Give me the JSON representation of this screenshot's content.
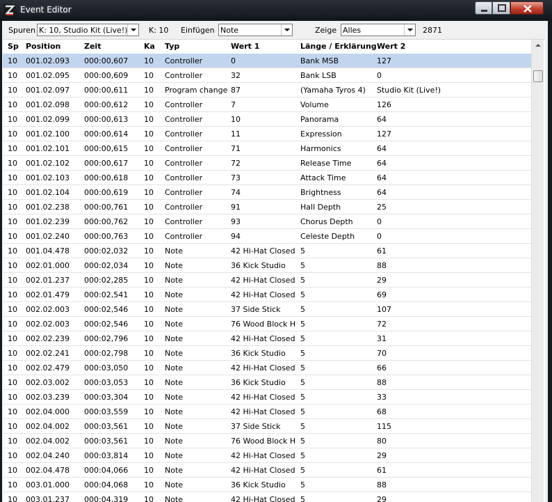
{
  "window": {
    "title": "Event Editor",
    "icon": "z-app-icon"
  },
  "toolbar": {
    "spuren_label": "Spuren",
    "spuren_value": "K: 10, Studio Kit (Live!)",
    "channel_label": "K: 10",
    "einfuegen_label": "Einfügen",
    "einfuegen_value": "Note",
    "zeige_label": "Zeige",
    "zeige_value": "Alles",
    "count": "2871"
  },
  "columns": {
    "sp": "Sp",
    "position": "Position",
    "zeit": "Zeit",
    "ka": "Ka",
    "typ": "Typ",
    "wert1": "Wert 1",
    "laenge": "Länge / Erklärung",
    "wert2": "Wert 2"
  },
  "selected_color": "#c1d5ee",
  "events": [
    {
      "sp": "10",
      "position": "001.02.093",
      "zeit": "000:00,607",
      "ka": "10",
      "typ": "Controller",
      "wert1": "0",
      "laenge": "Bank MSB",
      "wert2": "127"
    },
    {
      "sp": "10",
      "position": "001.02.095",
      "zeit": "000:00,609",
      "ka": "10",
      "typ": "Controller",
      "wert1": "32",
      "laenge": "Bank LSB",
      "wert2": "0"
    },
    {
      "sp": "10",
      "position": "001.02.097",
      "zeit": "000:00,611",
      "ka": "10",
      "typ": "Program change",
      "wert1": "87",
      "laenge": "(Yamaha Tyros 4)",
      "wert2": "Studio Kit (Live!)"
    },
    {
      "sp": "10",
      "position": "001.02.098",
      "zeit": "000:00,612",
      "ka": "10",
      "typ": "Controller",
      "wert1": "7",
      "laenge": "Volume",
      "wert2": "126"
    },
    {
      "sp": "10",
      "position": "001.02.099",
      "zeit": "000:00,613",
      "ka": "10",
      "typ": "Controller",
      "wert1": "10",
      "laenge": "Panorama",
      "wert2": "64"
    },
    {
      "sp": "10",
      "position": "001.02.100",
      "zeit": "000:00,614",
      "ka": "10",
      "typ": "Controller",
      "wert1": "11",
      "laenge": "Expression",
      "wert2": "127"
    },
    {
      "sp": "10",
      "position": "001.02.101",
      "zeit": "000:00,615",
      "ka": "10",
      "typ": "Controller",
      "wert1": "71",
      "laenge": "Harmonics",
      "wert2": "64"
    },
    {
      "sp": "10",
      "position": "001.02.102",
      "zeit": "000:00,617",
      "ka": "10",
      "typ": "Controller",
      "wert1": "72",
      "laenge": "Release Time",
      "wert2": "64"
    },
    {
      "sp": "10",
      "position": "001.02.103",
      "zeit": "000:00,618",
      "ka": "10",
      "typ": "Controller",
      "wert1": "73",
      "laenge": "Attack Time",
      "wert2": "64"
    },
    {
      "sp": "10",
      "position": "001.02.104",
      "zeit": "000:00,619",
      "ka": "10",
      "typ": "Controller",
      "wert1": "74",
      "laenge": "Brightness",
      "wert2": "64"
    },
    {
      "sp": "10",
      "position": "001.02.238",
      "zeit": "000:00,761",
      "ka": "10",
      "typ": "Controller",
      "wert1": "91",
      "laenge": "Hall Depth",
      "wert2": "25"
    },
    {
      "sp": "10",
      "position": "001.02.239",
      "zeit": "000:00,762",
      "ka": "10",
      "typ": "Controller",
      "wert1": "93",
      "laenge": "Chorus Depth",
      "wert2": "0"
    },
    {
      "sp": "10",
      "position": "001.02.240",
      "zeit": "000:00,763",
      "ka": "10",
      "typ": "Controller",
      "wert1": "94",
      "laenge": "Celeste Depth",
      "wert2": "0"
    },
    {
      "sp": "10",
      "position": "001.04.478",
      "zeit": "000:02,032",
      "ka": "10",
      "typ": "Note",
      "wert1": "42 Hi-Hat Closed",
      "laenge": "5",
      "wert2": "61"
    },
    {
      "sp": "10",
      "position": "002.01.000",
      "zeit": "000:02,034",
      "ka": "10",
      "typ": "Note",
      "wert1": "36 Kick Studio",
      "laenge": "5",
      "wert2": "88"
    },
    {
      "sp": "10",
      "position": "002.01.237",
      "zeit": "000:02,285",
      "ka": "10",
      "typ": "Note",
      "wert1": "42 Hi-Hat Closed",
      "laenge": "5",
      "wert2": "29"
    },
    {
      "sp": "10",
      "position": "002.01.479",
      "zeit": "000:02,541",
      "ka": "10",
      "typ": "Note",
      "wert1": "42 Hi-Hat Closed",
      "laenge": "5",
      "wert2": "69"
    },
    {
      "sp": "10",
      "position": "002.02.003",
      "zeit": "000:02,546",
      "ka": "10",
      "typ": "Note",
      "wert1": "37 Side Stick",
      "laenge": "5",
      "wert2": "107"
    },
    {
      "sp": "10",
      "position": "002.02.003",
      "zeit": "000:02,546",
      "ka": "10",
      "typ": "Note",
      "wert1": "76 Wood Block H",
      "laenge": "5",
      "wert2": "72"
    },
    {
      "sp": "10",
      "position": "002.02.239",
      "zeit": "000:02,796",
      "ka": "10",
      "typ": "Note",
      "wert1": "42 Hi-Hat Closed",
      "laenge": "5",
      "wert2": "31"
    },
    {
      "sp": "10",
      "position": "002.02.241",
      "zeit": "000:02,798",
      "ka": "10",
      "typ": "Note",
      "wert1": "36 Kick Studio",
      "laenge": "5",
      "wert2": "70"
    },
    {
      "sp": "10",
      "position": "002.02.479",
      "zeit": "000:03,050",
      "ka": "10",
      "typ": "Note",
      "wert1": "42 Hi-Hat Closed",
      "laenge": "5",
      "wert2": "66"
    },
    {
      "sp": "10",
      "position": "002.03.002",
      "zeit": "000:03,053",
      "ka": "10",
      "typ": "Note",
      "wert1": "36 Kick Studio",
      "laenge": "5",
      "wert2": "88"
    },
    {
      "sp": "10",
      "position": "002.03.239",
      "zeit": "000:03,304",
      "ka": "10",
      "typ": "Note",
      "wert1": "42 Hi-Hat Closed",
      "laenge": "5",
      "wert2": "33"
    },
    {
      "sp": "10",
      "position": "002.04.000",
      "zeit": "000:03,559",
      "ka": "10",
      "typ": "Note",
      "wert1": "42 Hi-Hat Closed",
      "laenge": "5",
      "wert2": "68"
    },
    {
      "sp": "10",
      "position": "002.04.002",
      "zeit": "000:03,561",
      "ka": "10",
      "typ": "Note",
      "wert1": "37 Side Stick",
      "laenge": "5",
      "wert2": "115"
    },
    {
      "sp": "10",
      "position": "002.04.002",
      "zeit": "000:03,561",
      "ka": "10",
      "typ": "Note",
      "wert1": "76 Wood Block H",
      "laenge": "5",
      "wert2": "80"
    },
    {
      "sp": "10",
      "position": "002.04.240",
      "zeit": "000:03,814",
      "ka": "10",
      "typ": "Note",
      "wert1": "42 Hi-Hat Closed",
      "laenge": "5",
      "wert2": "29"
    },
    {
      "sp": "10",
      "position": "002.04.478",
      "zeit": "000:04,066",
      "ka": "10",
      "typ": "Note",
      "wert1": "42 Hi-Hat Closed",
      "laenge": "5",
      "wert2": "61"
    },
    {
      "sp": "10",
      "position": "003.01.000",
      "zeit": "000:04,068",
      "ka": "10",
      "typ": "Note",
      "wert1": "36 Kick Studio",
      "laenge": "5",
      "wert2": "88"
    },
    {
      "sp": "10",
      "position": "003.01.237",
      "zeit": "000:04,319",
      "ka": "10",
      "typ": "Note",
      "wert1": "42 Hi-Hat Closed",
      "laenge": "5",
      "wert2": "29"
    }
  ],
  "selected_index": 0
}
